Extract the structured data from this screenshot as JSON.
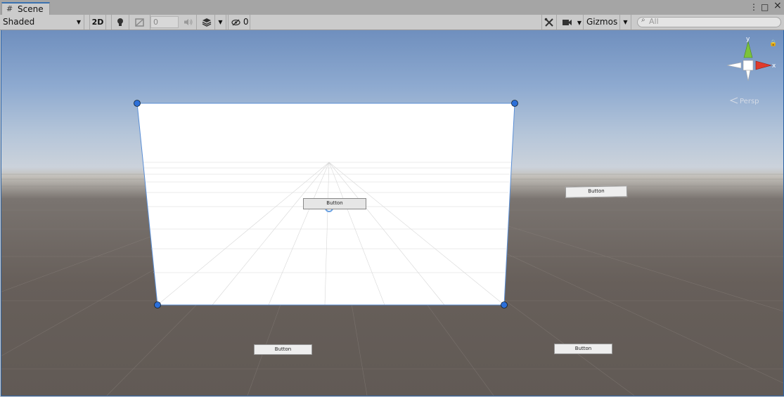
{
  "tab": {
    "icon": "grid-icon",
    "label": "Scene"
  },
  "window_controls": {
    "menu": "⋮",
    "maximize": "□",
    "close": "×"
  },
  "toolbar": {
    "shading_mode": "Shaded",
    "mode_2d": "2D",
    "fx_value": "0",
    "hidden_count": "0",
    "gizmos_label": "Gizmos",
    "search_placeholder": "All"
  },
  "gizmo": {
    "x_label": "x",
    "y_label": "y",
    "projection": "Persp"
  },
  "buttons": {
    "canvas_button": "Button",
    "world_button_right_top": "Button",
    "world_button_left_bottom": "Button",
    "world_button_right_bottom": "Button"
  },
  "colors": {
    "x_axis": "#e03a2b",
    "y_axis": "#7cc33a",
    "selection": "#2d65a8",
    "handle": "#2c6fd8"
  }
}
